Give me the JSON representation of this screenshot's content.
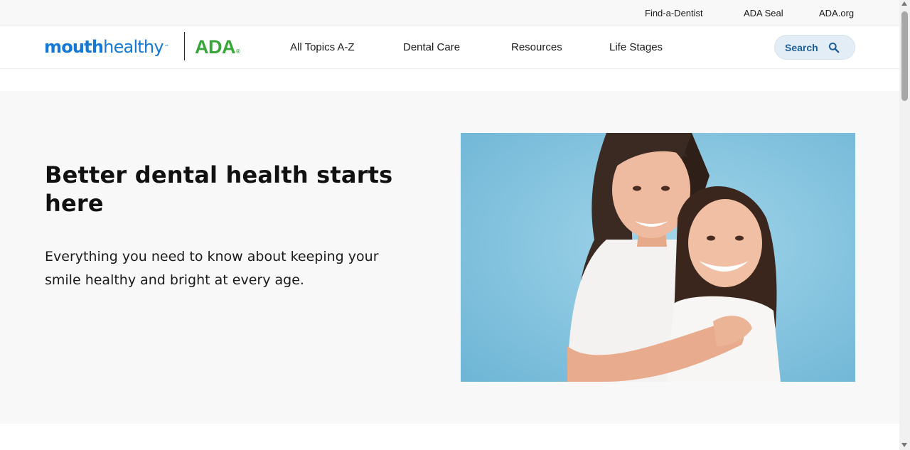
{
  "utility_nav": {
    "links": [
      {
        "label": "Find-a-Dentist"
      },
      {
        "label": "ADA Seal"
      },
      {
        "label": "ADA.org"
      }
    ]
  },
  "header": {
    "logo": {
      "mouth": "mouth",
      "healthy": "healthy",
      "tm": "™",
      "ada": "ADA",
      "registered": "®"
    },
    "nav": [
      {
        "label": "All Topics A-Z"
      },
      {
        "label": "Dental Care"
      },
      {
        "label": "Resources"
      },
      {
        "label": "Life Stages"
      }
    ],
    "search": {
      "label": "Search",
      "icon": "search-icon"
    }
  },
  "hero": {
    "title": "Better dental health starts here",
    "subtitle": "Everything you need to know about keeping your smile healthy and bright at every age.",
    "image_icon": "mother-and-daughter-photo"
  },
  "colors": {
    "brand_blue": "#1478d4",
    "brand_green": "#3aa53a",
    "search_bg": "#e3edf6",
    "search_text": "#1f5f95",
    "hero_bg": "#f8f8f8",
    "photo_bg": "#8ccae2"
  }
}
